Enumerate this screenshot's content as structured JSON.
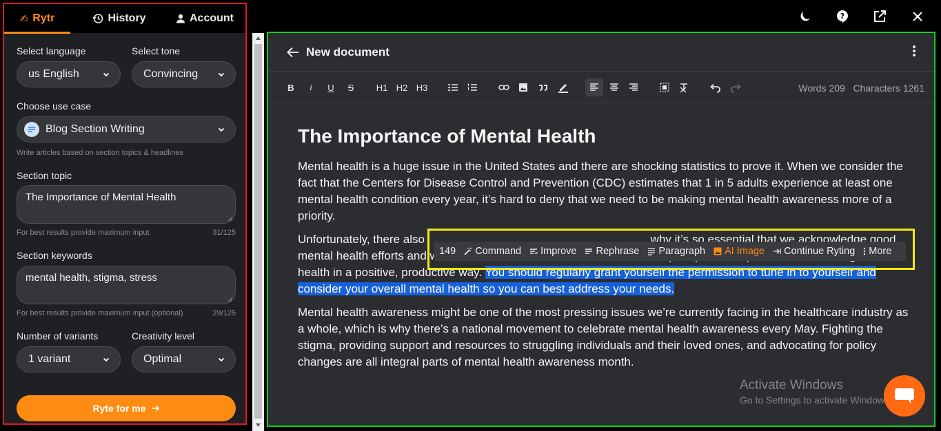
{
  "tabs": [
    {
      "label": "Rytr",
      "icon": "hand-writing-icon"
    },
    {
      "label": "History",
      "icon": "history-icon"
    },
    {
      "label": "Account",
      "icon": "user-icon"
    }
  ],
  "form": {
    "language_label": "Select language",
    "language_value": "us English",
    "tone_label": "Select tone",
    "tone_value": "Convincing",
    "usecase_label": "Choose use case",
    "usecase_value": "Blog Section Writing",
    "usecase_hint": "Write articles based on section topics & headlines",
    "topic_label": "Section topic",
    "topic_value": "The Importance of Mental Health",
    "topic_hint": "For best results provide maximum input",
    "topic_count": "31/125",
    "keywords_label": "Section keywords",
    "keywords_value": "mental health, stigma, stress",
    "keywords_hint": "For best results provide maximum input (optional)",
    "keywords_count": "29/125",
    "variants_label": "Number of variants",
    "variants_value": "1 variant",
    "creativity_label": "Creativity level",
    "creativity_value": "Optimal",
    "cta_label": "Ryte for me"
  },
  "editor": {
    "title": "New document",
    "toolbar": [
      "B",
      "i",
      "U",
      "S",
      "H1",
      "H2",
      "H3"
    ],
    "stats": "Words 209   Characters 1261",
    "heading": "The Importance of Mental Health",
    "p1": "Mental health is a huge issue in the United States and there are shocking statistics to prove it. When we consider the fact that the Centers for Disease Control and Prevention (CDC) estimates that 1 in 5 adults experience at least one mental health condition every year, it’s hard to deny that we need to be making mental health awareness more of a priority.",
    "p2_start": "Unfortunately, there also",
    "p2_mid": "why it’s so essential that we acknowledge good mental health efforts and work to overcome the barriers that have been put up that keep us from addressing mental health in a positive, productive way. ",
    "p2_selected": "You should regularly grant yourself the permission to tune in to yourself and consider your overall mental health so you can best address your needs.",
    "p3": "Mental health awareness might be one of the most pressing issues we’re currently facing in the healthcare industry as a whole, which is why there’s a national movement to celebrate mental health awareness every May. Fighting the stigma, providing support and resources to struggling individuals and their loved ones, and advocating for policy changes are all integral parts of mental health awareness month."
  },
  "float_toolbar": {
    "count": "149",
    "command": "Command",
    "improve": "Improve",
    "rephrase": "Rephrase",
    "paragraph": "Paragraph",
    "ai_image": "AI Image",
    "continue": "Continue Ryting",
    "more": "More"
  },
  "watermark": {
    "line1": "Activate Windows",
    "line2": "Go to Settings to activate Windows."
  },
  "colors": {
    "accent": "#ff8c12",
    "selection": "#1660d9",
    "left_outline": "#e3171f",
    "editor_outline": "#0fd11e",
    "toolbar_outline": "#f1ea17"
  }
}
